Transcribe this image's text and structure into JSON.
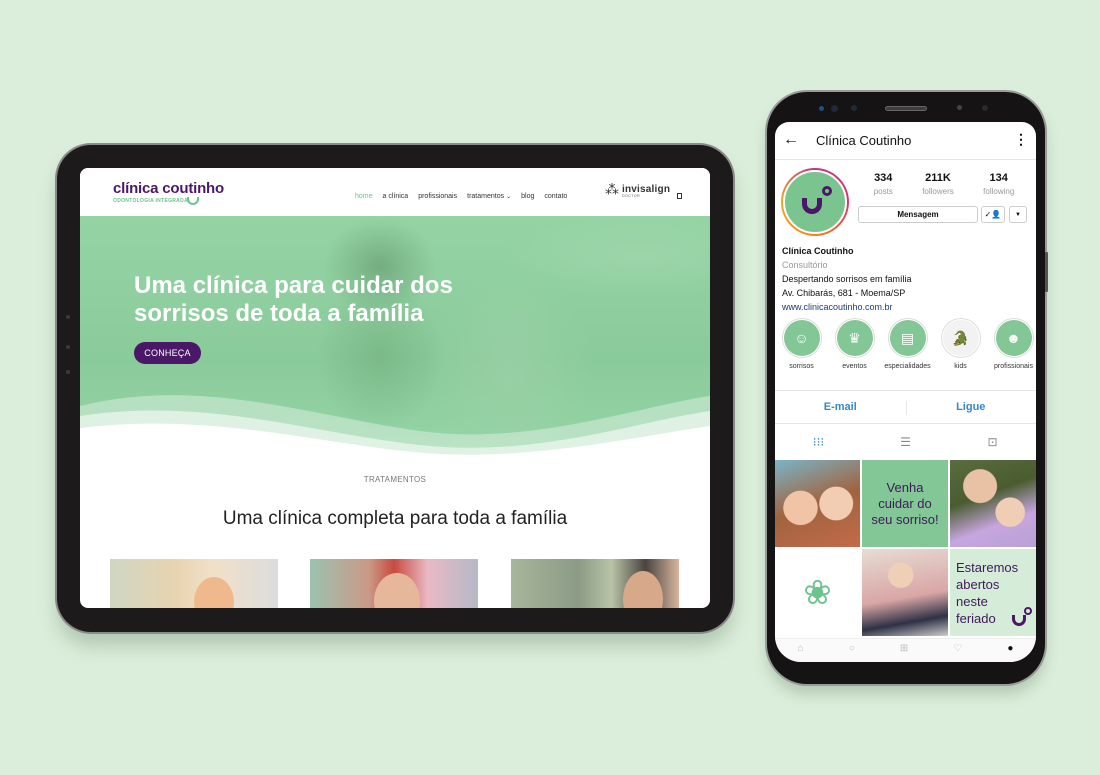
{
  "colors": {
    "background": "#dbeedb",
    "brand_purple": "#4b1767",
    "brand_green": "#6cc38c",
    "hero_green": "#8ecf9f",
    "ig_link_blue": "#3a86c8"
  },
  "website": {
    "logo": {
      "name_prefix": "clínica coutinh",
      "name_suffix": "o",
      "tagline": "ODONTOLOGIA INTEGRADA"
    },
    "nav": [
      {
        "label": "home",
        "active": true
      },
      {
        "label": "a clínica",
        "active": false
      },
      {
        "label": "profissionais",
        "active": false
      },
      {
        "label": "tratamentos",
        "active": false,
        "has_dropdown": true
      },
      {
        "label": "blog",
        "active": false
      },
      {
        "label": "contato",
        "active": false
      }
    ],
    "partner": {
      "icon": "invisalign-star-icon",
      "name": "invisalign",
      "subtitle": "DOCTOR"
    },
    "cart_icon": "cart-icon",
    "hero": {
      "title_line1": "Uma clínica para cuidar dos",
      "title_line2": "sorrisos de toda a família",
      "cta_label": "CONHEÇA"
    },
    "section": {
      "label": "TRATAMENTOS",
      "title": "Uma clínica completa para toda a família"
    }
  },
  "instagram": {
    "back_icon": "←",
    "more_icon": "⋮",
    "profile_title": "Clínica Coutinho",
    "stats": [
      {
        "value": "334",
        "label": "posts"
      },
      {
        "value": "211K",
        "label": "followers"
      },
      {
        "value": "134",
        "label": "following"
      }
    ],
    "message_button": "Mensagem",
    "follow_icon": "✓👤",
    "dropdown_icon": "▼",
    "bio": {
      "name": "Clínica Coutinho",
      "category": "Consultório",
      "line1": "Despertando sorrisos em família",
      "line2": "Av. Chibarás, 681 - Moema/SP",
      "website": "www.clinicacoutinho.com.br"
    },
    "highlights": [
      {
        "label": "sorrisos",
        "icon": "☺"
      },
      {
        "label": "eventos",
        "icon": "♛"
      },
      {
        "label": "especialidades",
        "icon": "▤"
      },
      {
        "label": "kids",
        "icon": "🐊"
      },
      {
        "label": "profissionais",
        "icon": "☻"
      }
    ],
    "contact": {
      "email": "E-mail",
      "call": "Ligue"
    },
    "tabs": [
      {
        "name": "grid",
        "icon": "⁝⁝⁝",
        "active": true
      },
      {
        "name": "list",
        "icon": "☰",
        "active": false
      },
      {
        "name": "tagged",
        "icon": "⊡",
        "active": false
      }
    ],
    "posts": {
      "post2_text": [
        "Venha",
        "cuidar do",
        "seu sorriso!"
      ],
      "post4_icon": "❀",
      "post6_text": [
        "Estaremos",
        "abertos",
        "neste",
        "feriado"
      ]
    },
    "bottom_nav": [
      "⌂",
      "○",
      "⊞",
      "♡",
      "●"
    ]
  }
}
